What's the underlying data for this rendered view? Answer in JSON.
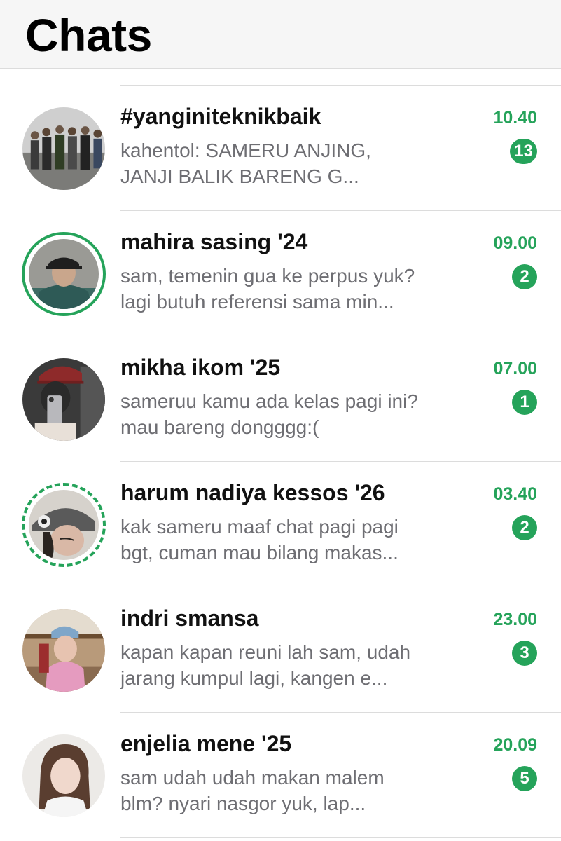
{
  "header": {
    "title": "Chats"
  },
  "colors": {
    "accent": "#25a35a",
    "preview_text": "#6e6e73",
    "divider": "#dcdcdc"
  },
  "chats": [
    {
      "name": "#yanginiteknikbaik",
      "preview_line1": "kahentol: SAMERU ANJING,",
      "preview_line2": "JANJI BALIK BARENG G...",
      "time": "10.40",
      "unread": "13"
    },
    {
      "name": "mahira sasing '24",
      "preview_line1": "sam, temenin gua ke perpus yuk?",
      "preview_line2": "lagi butuh referensi sama min...",
      "time": "09.00",
      "unread": "2"
    },
    {
      "name": "mikha ikom '25",
      "preview_line1": "sameruu kamu ada kelas pagi ini?",
      "preview_line2": "mau bareng dongggg:(",
      "time": "07.00",
      "unread": "1"
    },
    {
      "name": "harum nadiya kessos '26",
      "preview_line1": "kak sameru maaf chat pagi pagi",
      "preview_line2": "bgt, cuman mau bilang makas...",
      "time": "03.40",
      "unread": "2"
    },
    {
      "name": "indri smansa",
      "preview_line1": "kapan kapan reuni lah sam, udah",
      "preview_line2": "jarang kumpul lagi, kangen e...",
      "time": "23.00",
      "unread": "3"
    },
    {
      "name": "enjelia mene '25",
      "preview_line1": "sam udah udah makan malem",
      "preview_line2": "blm? nyari nasgor yuk, lap...",
      "time": "20.09",
      "unread": "5"
    }
  ]
}
